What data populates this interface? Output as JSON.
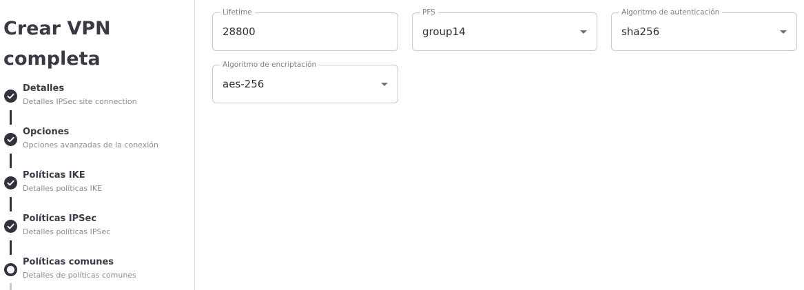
{
  "sidebar": {
    "title": "Crear VPN completa",
    "steps": [
      {
        "title": "Detalles",
        "subtitle": "Detalles IPSec site connection",
        "status": "completed"
      },
      {
        "title": "Opciones",
        "subtitle": "Opciones avanzadas de la conexión",
        "status": "completed"
      },
      {
        "title": "Políticas IKE",
        "subtitle": "Detalles políticas IKE",
        "status": "completed"
      },
      {
        "title": "Políticas IPSec",
        "subtitle": "Detalles políticas IPSec",
        "status": "completed"
      },
      {
        "title": "Políticas comunes",
        "subtitle": "Detalles de políticas comunes",
        "status": "current"
      }
    ]
  },
  "form": {
    "lifetime": {
      "label": "Lifetime",
      "value": "28800"
    },
    "pfs": {
      "label": "PFS",
      "value": "group14",
      "icon": "chevron-down-icon"
    },
    "auth_algorithm": {
      "label": "Algoritmo de autenticación",
      "value": "sha256",
      "icon": "chevron-down-icon"
    },
    "encryption_algorithm": {
      "label": "Algoritmo de encriptación",
      "value": "aes-256",
      "icon": "chevron-down-icon"
    }
  },
  "colors": {
    "step_complete": "#32323c",
    "border": "#c8c8cc"
  }
}
